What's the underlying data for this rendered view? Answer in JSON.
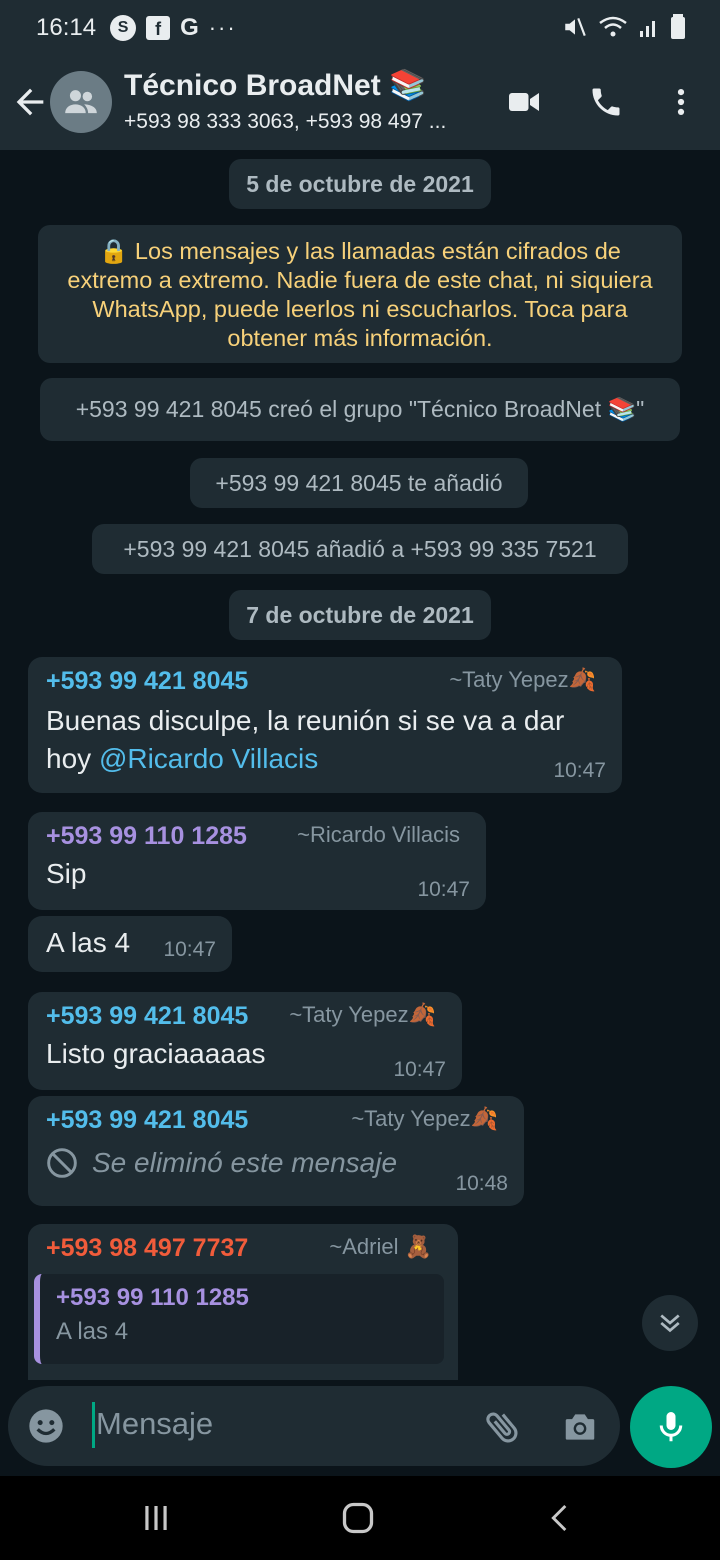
{
  "status_bar": {
    "time": "16:14",
    "icons": [
      "skype-icon",
      "facebook-icon",
      "google-icon",
      "more-dots-icon",
      "mute-icon",
      "wifi-icon",
      "signal-icon",
      "battery-icon"
    ]
  },
  "header": {
    "title": "Técnico BroadNet 📚",
    "subtitle": "+593 98 333 3063, +593 98 497 ..."
  },
  "chat": {
    "date1": "5 de octubre de 2021",
    "encryption": "🔒 Los mensajes y las llamadas están cifrados de extremo a extremo. Nadie fuera de este chat, ni siquiera WhatsApp, puede leerlos ni escucharlos. Toca para obtener más información.",
    "system1": "+593 99 421 8045 creó el grupo \"Técnico BroadNet 📚\"",
    "system2": "+593 99 421 8045 te añadió",
    "system3": "+593 99 421 8045 añadió a +593 99 335 7521",
    "date2": "7 de octubre de 2021",
    "messages": [
      {
        "sender": "+593 99 421 8045",
        "alias": "~Taty Yepez🍂",
        "text": "Buenas disculpe, la reunión si se va a dar hoy ",
        "mention": "@Ricardo Villacis",
        "time": "10:47",
        "color": "#53bdeb"
      },
      {
        "sender": "+593 99 110 1285",
        "alias": "~Ricardo Villacis",
        "text": "Sip",
        "time": "10:47",
        "color": "#a791e0"
      },
      {
        "text": "A las 4",
        "time": "10:47"
      },
      {
        "sender": "+593 99 421 8045",
        "alias": "~Taty Yepez🍂",
        "text": "Listo graciaaaaas",
        "time": "10:47",
        "color": "#53bdeb"
      },
      {
        "sender": "+593 99 421 8045",
        "alias": "~Taty Yepez🍂",
        "text": "Se eliminó este mensaje",
        "time": "10:48",
        "color": "#53bdeb"
      },
      {
        "sender": "+593 98 497 7737",
        "alias": "~Adriel 🧸",
        "quote_sender": "+593 99 110 1285",
        "quote_text": "A las 4",
        "color": "#f15c3b"
      }
    ]
  },
  "input": {
    "placeholder": "Mensaje"
  },
  "colors": {
    "accent": "#00a884",
    "bubble": "#1f2c33",
    "background": "#0b141a",
    "system_text": "#f7d17a"
  }
}
